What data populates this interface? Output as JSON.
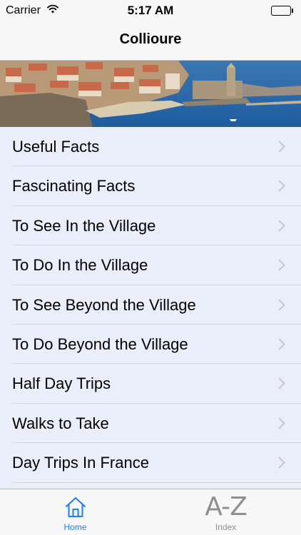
{
  "status_bar": {
    "carrier": "Carrier",
    "time": "5:17 AM",
    "battery_level": 1.0
  },
  "nav": {
    "title": "Collioure"
  },
  "menu": {
    "items": [
      {
        "label": "Useful Facts",
        "icon": "chevron-right-icon"
      },
      {
        "label": "Fascinating Facts",
        "icon": "chevron-right-icon"
      },
      {
        "label": "To See In the Village",
        "icon": "chevron-right-icon"
      },
      {
        "label": "To Do In the Village",
        "icon": "chevron-right-icon"
      },
      {
        "label": "To See Beyond the Village",
        "icon": "chevron-right-icon"
      },
      {
        "label": "To Do Beyond the Village",
        "icon": "chevron-right-icon"
      },
      {
        "label": "Half Day Trips",
        "icon": "chevron-right-icon"
      },
      {
        "label": "Walks to Take",
        "icon": "chevron-right-icon"
      },
      {
        "label": "Day Trips In France",
        "icon": "chevron-right-icon"
      }
    ]
  },
  "tabs": [
    {
      "label": "Home",
      "icon": "house-icon",
      "selected": true
    },
    {
      "label": "Index",
      "icon": "a-z-icon",
      "icon_text": "A-Z",
      "selected": false
    }
  ],
  "colors": {
    "accent": "#1a7ff5",
    "inactive": "#8e8e93",
    "list_background": "#eaedfa",
    "bar_background": "#f7f7f7"
  }
}
